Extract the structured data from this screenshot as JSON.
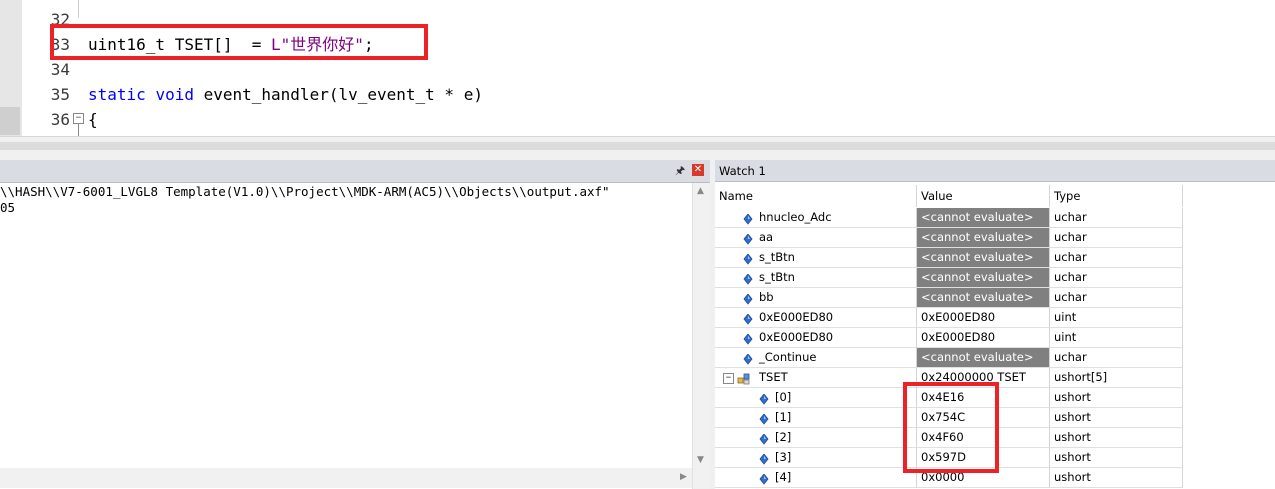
{
  "editor": {
    "lines": [
      {
        "num": "32",
        "code_parts": []
      },
      {
        "num": "33",
        "code_parts": [
          {
            "t": "uint16_t TSET[]  = ",
            "c": "plain"
          },
          {
            "t": "L\"世界你好\"",
            "c": "str"
          },
          {
            "t": ";",
            "c": "plain"
          }
        ]
      },
      {
        "num": "34",
        "code_parts": []
      },
      {
        "num": "35",
        "code_parts": [
          {
            "t": "static",
            "c": "kw"
          },
          {
            "t": " ",
            "c": "plain"
          },
          {
            "t": "void",
            "c": "kw"
          },
          {
            "t": " event_handler(lv_event_t * e)",
            "c": "plain"
          }
        ]
      },
      {
        "num": "36",
        "code_parts": [
          {
            "t": "{",
            "c": "plain"
          }
        ]
      }
    ]
  },
  "output": {
    "line1": "\\\\HASH\\\\V7-6001_LVGL8 Template(V1.0)\\\\Project\\\\MDK-ARM(AC5)\\\\Objects\\\\output.axf\"",
    "line2": "05"
  },
  "watch": {
    "title": "Watch 1",
    "columns": {
      "name": "Name",
      "value": "Value",
      "type": "Type"
    },
    "rows": [
      {
        "name": "hnucleo_Adc",
        "value": "<cannot evaluate>",
        "type": "uchar",
        "grey": true
      },
      {
        "name": "aa",
        "value": "<cannot evaluate>",
        "type": "uchar",
        "grey": true
      },
      {
        "name": "s_tBtn",
        "value": "<cannot evaluate>",
        "type": "uchar",
        "grey": true
      },
      {
        "name": "s_tBtn",
        "value": "<cannot evaluate>",
        "type": "uchar",
        "grey": true
      },
      {
        "name": "bb",
        "value": "<cannot evaluate>",
        "type": "uchar",
        "grey": true
      },
      {
        "name": "0xE000ED80",
        "value": "0xE000ED80",
        "type": "uint",
        "grey": false
      },
      {
        "name": "0xE000ED80",
        "value": "0xE000ED80",
        "type": "uint",
        "grey": false
      },
      {
        "name": "_Continue",
        "value": "<cannot evaluate>",
        "type": "uchar",
        "grey": true
      },
      {
        "name": "TSET",
        "value": "0x24000000 TSET",
        "type": "ushort[5]",
        "grey": false,
        "expanded": true
      },
      {
        "name": "[0]",
        "value": "0x4E16",
        "type": "ushort",
        "grey": false,
        "child": true
      },
      {
        "name": "[1]",
        "value": "0x754C",
        "type": "ushort",
        "grey": false,
        "child": true
      },
      {
        "name": "[2]",
        "value": "0x4F60",
        "type": "ushort",
        "grey": false,
        "child": true
      },
      {
        "name": "[3]",
        "value": "0x597D",
        "type": "ushort",
        "grey": false,
        "child": true
      },
      {
        "name": "[4]",
        "value": "0x0000",
        "type": "ushort",
        "grey": false,
        "child": true
      }
    ]
  },
  "colors": {
    "highlight_border": "#ec2226",
    "keyword": "#0000ff",
    "string": "#800080",
    "grey_cell": "#808080"
  },
  "icons": {
    "watch_item": "blue-diamond-icon",
    "struct": "struct-icon",
    "pin": "pin-icon",
    "close": "close-icon"
  }
}
